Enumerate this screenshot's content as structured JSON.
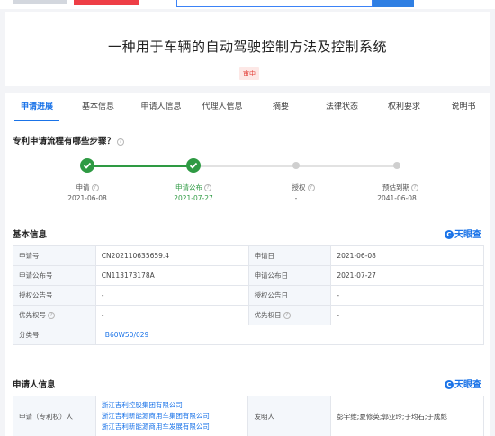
{
  "topbar": {
    "ad_text": ""
  },
  "title": "一种用于车辆的自动驾驶控制方法及控制系统",
  "status_badge": "审中",
  "tabs": [
    "申请进展",
    "基本信息",
    "申请人信息",
    "代理人信息",
    "摘要",
    "法律状态",
    "权利要求",
    "说明书"
  ],
  "progress": {
    "title": "专利申请流程有哪些步骤？",
    "steps": [
      {
        "name": "申请",
        "date": "2021-06-08",
        "state": "done"
      },
      {
        "name": "申请公布",
        "date": "2021-07-27",
        "state": "done"
      },
      {
        "name": "授权",
        "date": "-",
        "state": "todo"
      },
      {
        "name": "预估到期",
        "date": "2041-06-08",
        "state": "todo"
      }
    ]
  },
  "basic_info": {
    "title": "基本信息",
    "brand": "天眼查",
    "rows": [
      {
        "k1": "申请号",
        "v1": "CN202110635659.4",
        "k2": "申请日",
        "v2": "2021-06-08"
      },
      {
        "k1": "申请公布号",
        "v1": "CN113173178A",
        "k2": "申请公布日",
        "v2": "2021-07-27"
      },
      {
        "k1": "授权公告号",
        "v1": "-",
        "k2": "授权公告日",
        "v2": "-"
      },
      {
        "k1": "优先权号",
        "v1": "-",
        "k2": "优先权日",
        "v2": "-"
      }
    ],
    "class_label": "分类号",
    "class_value": "B60W50/029"
  },
  "applicant_info": {
    "title": "申请人信息",
    "brand": "天眼查",
    "applicant_label": "申请（专利权）人",
    "applicants": [
      "浙江吉利控股集团有限公司",
      "浙江吉利新能源商用车集团有限公司",
      "浙江吉利新能源商用车发展有限公司"
    ],
    "inventor_label": "发明人",
    "inventors": "彭宇维;夏修英;郭亚玲;于均石;于成彪"
  },
  "colors": {
    "accent": "#1a73e8",
    "done": "#2e9a43",
    "pending": "#cfcfcf",
    "badge": "#e3413a"
  }
}
